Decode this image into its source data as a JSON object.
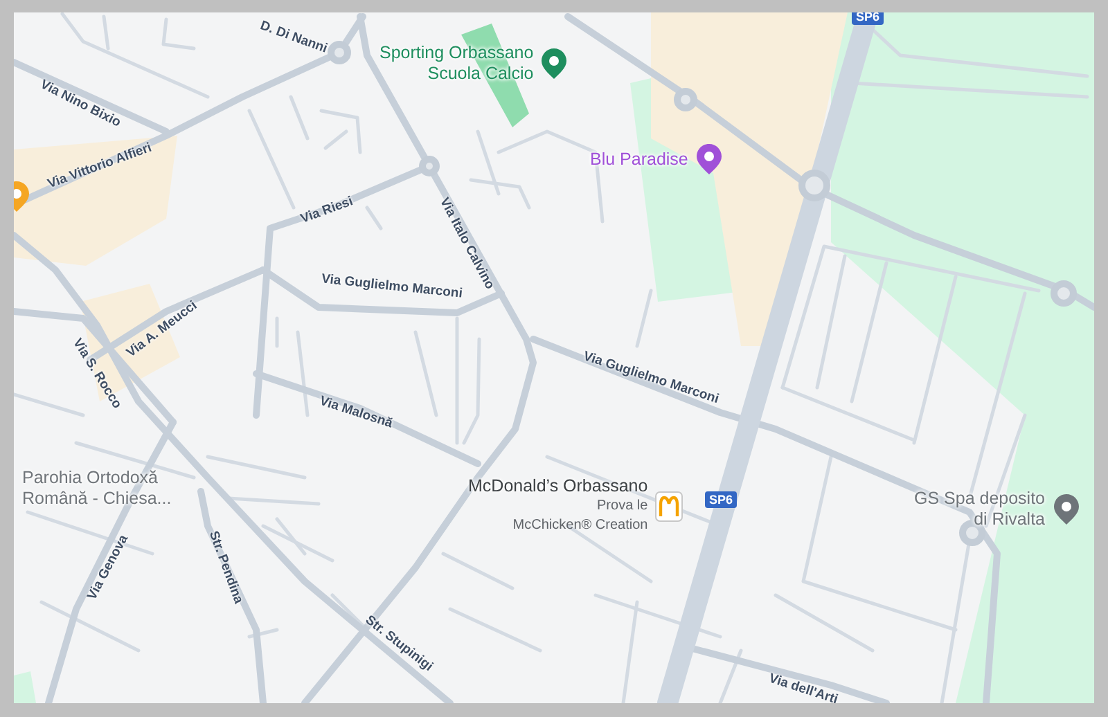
{
  "map": {
    "streets": [
      {
        "name": "D. Di Nanni"
      },
      {
        "name": "Via Nino Bixio"
      },
      {
        "name": "Via Vittorio Alfieri"
      },
      {
        "name": "Via Riesi"
      },
      {
        "name": "Via Italo Calvino"
      },
      {
        "name": "Via Guglielmo Marconi"
      },
      {
        "name": "Via A. Meucci"
      },
      {
        "name": "Via S. Rocco"
      },
      {
        "name": "Via Guglielmo Marconi"
      },
      {
        "name": "Via Malosnă"
      },
      {
        "name": "Via Genova"
      },
      {
        "name": "Str. Pendina"
      },
      {
        "name": "Str. Stupinigi"
      },
      {
        "name": "Via dell'Arti"
      }
    ],
    "route_shields": [
      {
        "label": "SP6"
      },
      {
        "label": "SP6"
      }
    ],
    "places": [
      {
        "kind": "pin",
        "color": "#1e8e5e",
        "lines": [
          "Sporting Orbassano",
          "Scuola Calcio"
        ]
      },
      {
        "kind": "pin",
        "color": "#a050d8",
        "lines": [
          "Blu Paradise"
        ]
      },
      {
        "kind": "logo",
        "color": "#f5a300",
        "lines": [
          "McDonald’s Orbassano"
        ],
        "details": [
          "Prova le",
          "McChicken® Creation"
        ]
      },
      {
        "kind": "pin",
        "color": "#6e7479",
        "lines": [
          "GS Spa deposito",
          "di Rivalta"
        ]
      },
      {
        "kind": "label",
        "lines": [
          "Parohia Ortodoxă",
          "Română - Chiesa..."
        ]
      },
      {
        "kind": "pin",
        "color": "#f5a623"
      }
    ]
  }
}
